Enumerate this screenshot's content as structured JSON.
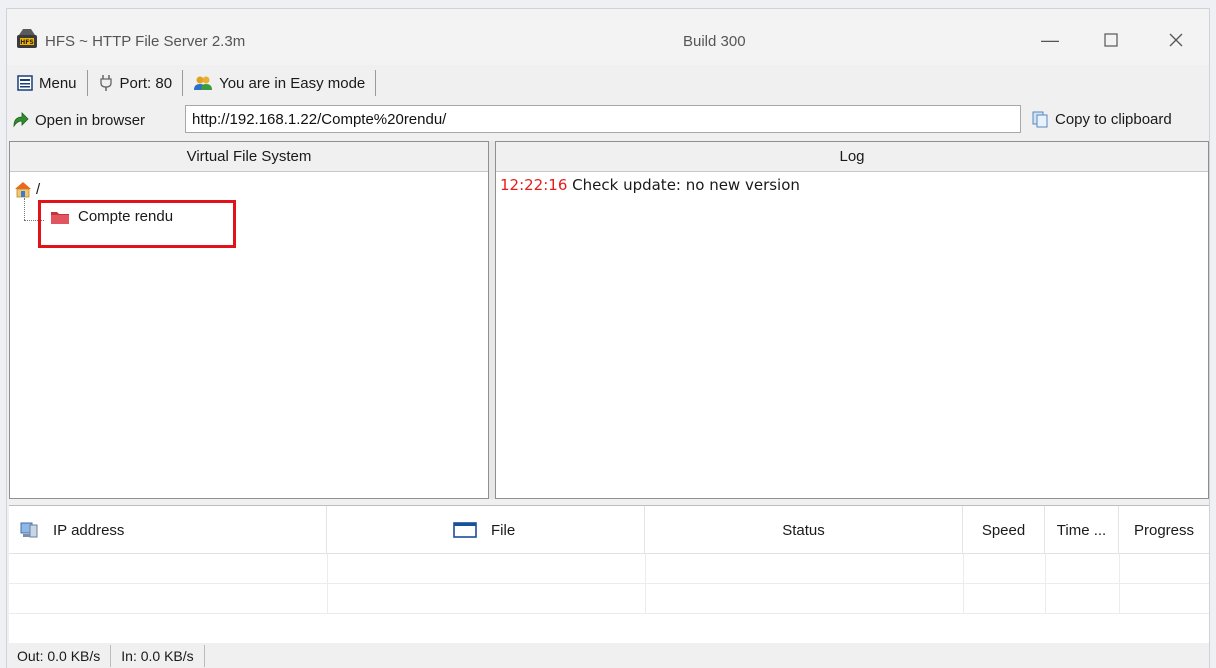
{
  "window": {
    "title": "HFS ~ HTTP File Server 2.3m",
    "build": "Build 300"
  },
  "toolbar": {
    "menu_label": "Menu",
    "port_label": "Port: 80",
    "mode_label": "You are in Easy mode"
  },
  "urlbar": {
    "open_label": "Open in browser",
    "url": "http://192.168.1.22/Compte%20rendu/",
    "copy_label": "Copy to clipboard"
  },
  "vfs": {
    "header": "Virtual File System",
    "root_label": "/",
    "items": [
      {
        "label": "Compte rendu"
      }
    ]
  },
  "log": {
    "header": "Log",
    "entries": [
      {
        "time": "12:22:16",
        "message": "Check update: no new version"
      }
    ]
  },
  "connections": {
    "columns": {
      "ip": "IP address",
      "file": "File",
      "status": "Status",
      "speed": "Speed",
      "time": "Time ...",
      "progress": "Progress"
    }
  },
  "statusbar": {
    "out": "Out: 0.0 KB/s",
    "in": "In: 0.0 KB/s"
  },
  "colors": {
    "highlight": "#e0131a",
    "log_time": "#e81c1c"
  }
}
